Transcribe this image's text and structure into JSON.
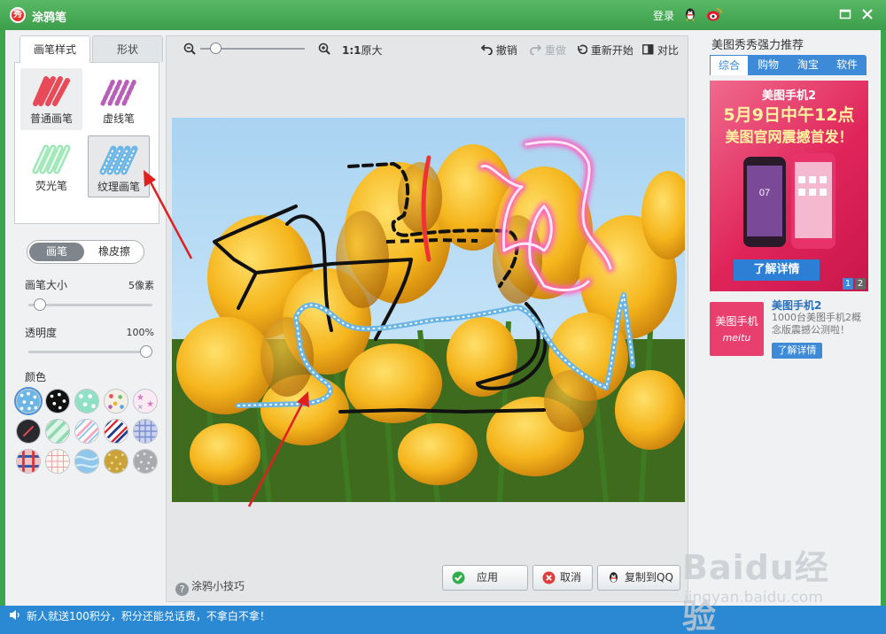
{
  "window": {
    "logo_char": "秀",
    "title": "涂鸦笔",
    "login": "登录"
  },
  "left": {
    "tabs": [
      "画笔样式",
      "形状"
    ],
    "brushes": [
      {
        "label": "普通画笔",
        "color": "#e84a57"
      },
      {
        "label": "虚线笔",
        "color": "#b85fb8"
      },
      {
        "label": "荧光笔",
        "color": "#9be6b4"
      },
      {
        "label": "纹理画笔",
        "color": "#6cb6e6"
      }
    ],
    "mode": {
      "pen": "画笔",
      "eraser": "橡皮擦"
    },
    "size": {
      "label": "画笔大小",
      "value": "5像素",
      "level": 0.05
    },
    "opacity": {
      "label": "透明度",
      "value": "100%",
      "level": 1.0
    },
    "color_label": "颜色"
  },
  "toolbar": {
    "zoom_value": "1:1",
    "original_size": "原大",
    "undo": "撤销",
    "redo": "重做",
    "restart": "重新开始",
    "compare": "对比"
  },
  "footer": {
    "tip_icon": "?",
    "tip": "涂鸦小技巧",
    "apply": "应用",
    "cancel": "取消",
    "copy_qq": "复制到QQ"
  },
  "ad": {
    "title": "美图秀秀强力推荐",
    "tabs": [
      "综合",
      "购物",
      "淘宝",
      "软件"
    ],
    "banner_line1": "美图手机2",
    "banner_line2": "5月9日中午12点",
    "banner_line3": "美图官网震撼首发！",
    "banner_button": "了解详情",
    "pages": [
      "1",
      "2"
    ],
    "item_thumb_line1": "美图手机",
    "item_thumb_line2": "meitu",
    "item_title": "美图手机2",
    "item_desc": "1000台美图手机2概念版震撼公测啦！",
    "item_button": "了解详情"
  },
  "status": {
    "text": "新人就送100积分，积分还能兑话费，不拿白不拿！"
  },
  "watermark": {
    "brand": "Baidu经验",
    "url": "jingyan.baidu.com"
  }
}
